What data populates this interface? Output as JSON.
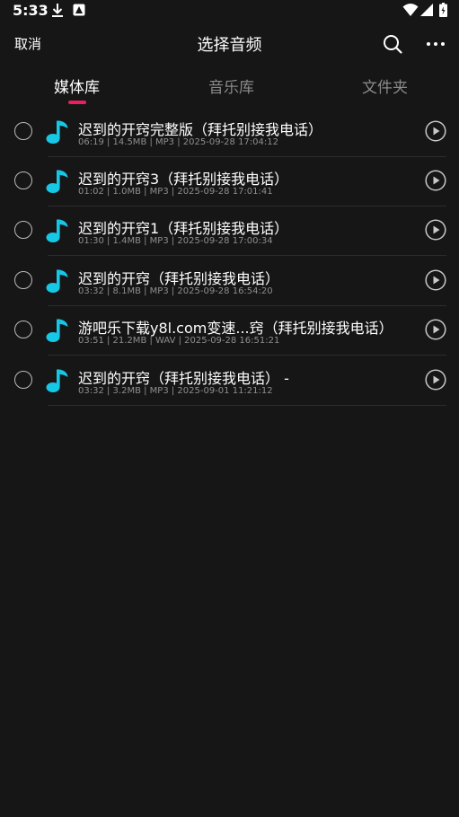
{
  "status_bar": {
    "time": "5:33"
  },
  "header": {
    "cancel_label": "取消",
    "title": "选择音频"
  },
  "tabs": [
    {
      "label": "媒体库",
      "active": true
    },
    {
      "label": "音乐库",
      "active": false
    },
    {
      "label": "文件夹",
      "active": false
    }
  ],
  "colors": {
    "accent": "#e8205e",
    "note_icon": "#17c8e6",
    "background": "#161616"
  },
  "files": [
    {
      "name": "迟到的开窍完整版（拜托别接我电话）",
      "meta": "06:19 | 14.5MB | MP3 | 2025-09-28 17:04:12"
    },
    {
      "name": "迟到的开窍3（拜托别接我电话）",
      "meta": "01:02 | 1.0MB | MP3 | 2025-09-28 17:01:41"
    },
    {
      "name": "迟到的开窍1（拜托别接我电话）",
      "meta": "01:30 | 1.4MB | MP3 | 2025-09-28 17:00:34"
    },
    {
      "name": "迟到的开窍（拜托别接我电话）",
      "meta": "03:32 | 8.1MB | MP3 | 2025-09-28 16:54:20"
    },
    {
      "name": "游吧乐下载y8l.com变速...窍（拜托别接我电话）",
      "meta": "03:51 | 21.2MB | WAV | 2025-09-28 16:51:21"
    },
    {
      "name": "迟到的开窍（拜托别接我电话） -",
      "meta": "03:32 | 3.2MB | MP3 | 2025-09-01 11:21:12"
    }
  ]
}
